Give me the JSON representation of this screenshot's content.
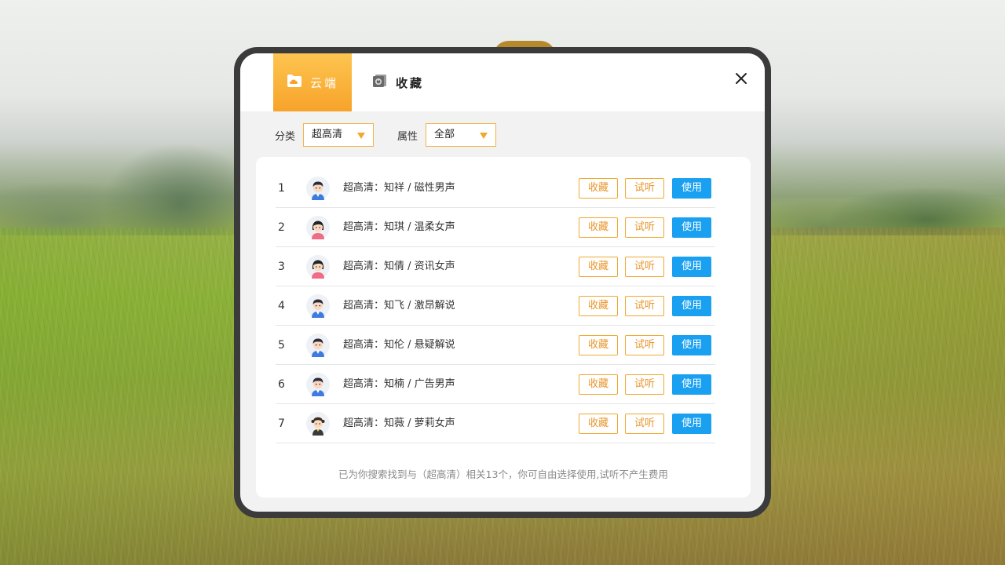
{
  "tabs": [
    {
      "label": "云端",
      "icon": "cloud-folder-icon",
      "active": true
    },
    {
      "label": "收藏",
      "icon": "collection-icon",
      "active": false
    }
  ],
  "filters": {
    "category_label": "分类",
    "category_value": "超高清",
    "attribute_label": "属性",
    "attribute_value": "全部"
  },
  "actions": {
    "favorite": "收藏",
    "preview": "试听",
    "use": "使用"
  },
  "voices": [
    {
      "index": "1",
      "name": "超高清：知祥 / 磁性男声",
      "avatar": "male"
    },
    {
      "index": "2",
      "name": "超高清：知琪 / 温柔女声",
      "avatar": "female"
    },
    {
      "index": "3",
      "name": "超高清：知倩 / 资讯女声",
      "avatar": "female"
    },
    {
      "index": "4",
      "name": "超高清：知飞 / 激昂解说",
      "avatar": "male"
    },
    {
      "index": "5",
      "name": "超高清：知伦 / 悬疑解说",
      "avatar": "male"
    },
    {
      "index": "6",
      "name": "超高清：知楠 / 广告男声",
      "avatar": "male"
    },
    {
      "index": "7",
      "name": "超高清：知薇 / 萝莉女声",
      "avatar": "girl"
    }
  ],
  "footer_note": "已为你搜索找到与（超高清）相关13个，你可自由选择使用,试听不产生费用",
  "colors": {
    "accent_orange": "#f7a32a",
    "use_blue": "#1aa0f0",
    "frame": "#3b3b3b"
  }
}
